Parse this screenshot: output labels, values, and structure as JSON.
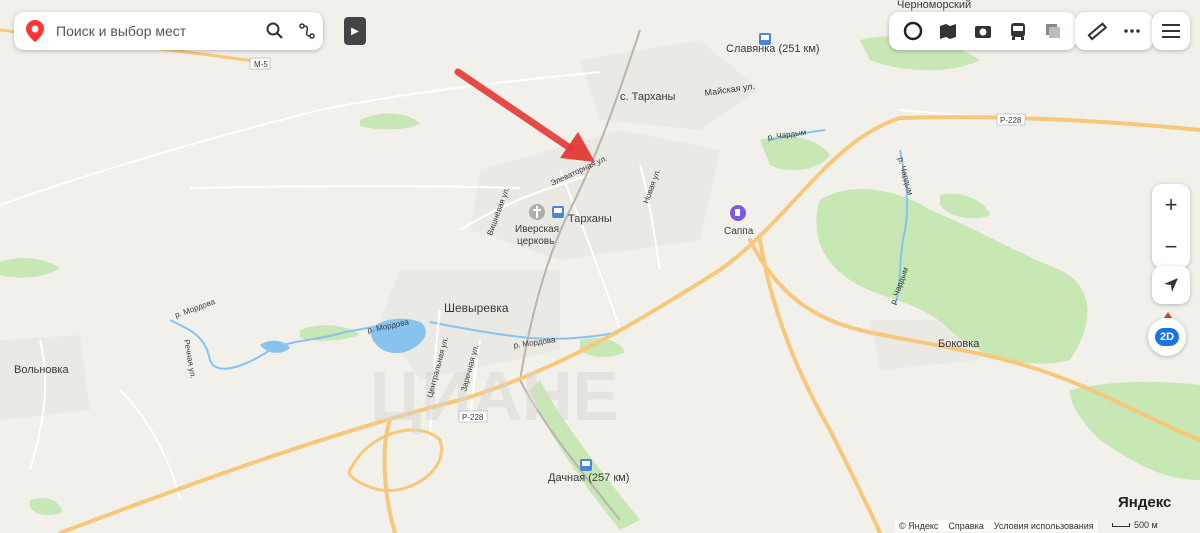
{
  "search": {
    "placeholder": "Поиск и выбор мест"
  },
  "toolbar": {
    "layers": [
      "circle-icon",
      "panorama-icon",
      "camera-icon",
      "transit-icon",
      "layers-icon"
    ],
    "tools": [
      "ruler-icon",
      "more-icon"
    ],
    "menu": "menu-icon"
  },
  "controls": {
    "zoom_in": "+",
    "zoom_out": "−",
    "view_mode": "2D"
  },
  "map_labels": {
    "chernomorsky": "Черноморский",
    "slavyanka": "Славянка (251 км)",
    "tarkhany_village": "с. Тарханы",
    "mayskaya": "Майская ул.",
    "chardym1": "р. Чардым",
    "chardym2": "р. Чардым",
    "chardym3": "р. Чардым",
    "r228_east": "Р-228",
    "r228_west": "Р-228",
    "m5": "М-5",
    "elevatornaya": "Элеваторная ул.",
    "vishnevaya": "Вишнёвая ул.",
    "iverskaya1": "Иверская",
    "iverskaya2": "церковь",
    "tarkhany_station": "Тарханы",
    "novaya": "Новая ул.",
    "sappa": "Саппа",
    "shevyrevka": "Шевыревка",
    "mordova1": "р. Мордова",
    "mordova2": "р. Мордова",
    "mordova3": "р. Мордова",
    "tsentralnaya": "Центральная ул.",
    "zarechnaya": "Заречная ул.",
    "volnovka": "Вольновка",
    "bokovka": "Боковка",
    "dachnaya": "Дачная (257 км)",
    "rechnaya": "Речная ул."
  },
  "footer": {
    "copyright": "© Яндекс",
    "help": "Справка",
    "terms": "Условия использования",
    "scale": "500 м",
    "logo": "Яндекс"
  },
  "colors": {
    "forest": "#c7e7b4",
    "road_main": "#f7c87a",
    "water": "#88c3f0",
    "arrow": "#e53935",
    "accent": "#1a73e8"
  }
}
